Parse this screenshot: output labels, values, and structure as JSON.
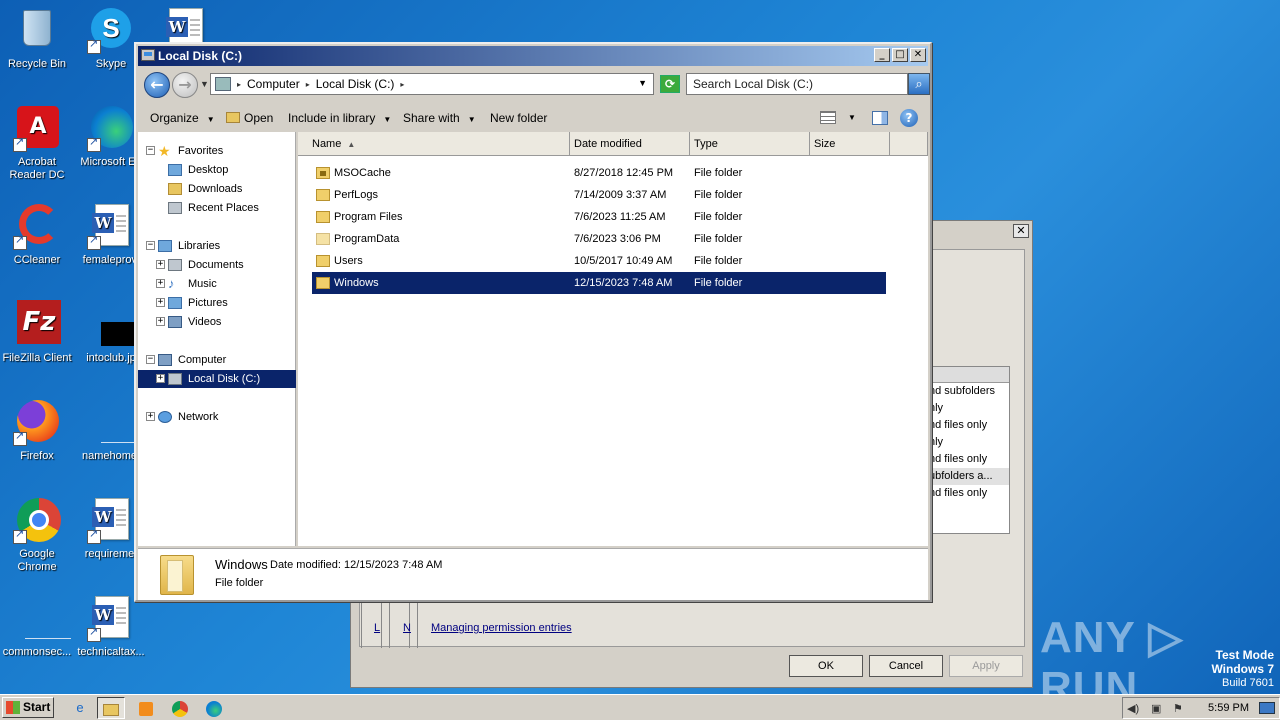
{
  "desktop": {
    "icons": [
      {
        "label": "Recycle Bin",
        "icon": "recycle-bin-icon"
      },
      {
        "label": "Skype",
        "icon": "skype-icon"
      },
      {
        "label": "",
        "icon": "word-document-icon"
      },
      {
        "label": "Acrobat Reader DC",
        "icon": "acrobat-icon"
      },
      {
        "label": "Microsoft Ed",
        "icon": "edge-icon"
      },
      {
        "label": "CCleaner",
        "icon": "ccleaner-icon"
      },
      {
        "label": "femaleprovi",
        "icon": "word-document-icon"
      },
      {
        "label": "FileZilla Client",
        "icon": "filezilla-icon"
      },
      {
        "label": "intoclub.jp",
        "icon": "image-file-icon"
      },
      {
        "label": "Firefox",
        "icon": "firefox-icon"
      },
      {
        "label": "namehome.",
        "icon": "file-icon"
      },
      {
        "label": "Google Chrome",
        "icon": "chrome-icon"
      },
      {
        "label": "requireme.",
        "icon": "word-document-icon"
      },
      {
        "label": "commonsec...",
        "icon": "file-icon"
      },
      {
        "label": "technicaltax...",
        "icon": "word-document-icon"
      }
    ]
  },
  "background_dialog": {
    "list_items": [
      "nd subfolders",
      "nly",
      "nd files only",
      "nly",
      "nd files only",
      "ubfolders a...",
      "nd files only"
    ],
    "link_fragments": [
      "L",
      "N"
    ],
    "link": "Managing permission entries",
    "buttons": {
      "ok": "OK",
      "cancel": "Cancel",
      "apply": "Apply"
    },
    "close": "✕"
  },
  "explorer": {
    "title": "Local Disk (C:)",
    "title_buttons": {
      "minimize": "_",
      "maximize": "□",
      "close": "✕"
    },
    "address": {
      "segments": [
        "Computer",
        "Local Disk (C:)"
      ]
    },
    "search_placeholder": "Search Local Disk (C:)",
    "toolbar": {
      "organize": "Organize",
      "open": "Open",
      "include": "Include in library",
      "share": "Share with",
      "new_folder": "New folder"
    },
    "nav": {
      "favorites": "Favorites",
      "desktop": "Desktop",
      "downloads": "Downloads",
      "recent": "Recent Places",
      "libraries": "Libraries",
      "documents": "Documents",
      "music": "Music",
      "pictures": "Pictures",
      "videos": "Videos",
      "computer": "Computer",
      "local_disk": "Local Disk (C:)",
      "network": "Network"
    },
    "columns": {
      "name": "Name",
      "date": "Date modified",
      "type": "Type",
      "size": "Size"
    },
    "files": [
      {
        "name": "MSOCache",
        "date": "8/27/2018 12:45 PM",
        "type": "File folder"
      },
      {
        "name": "PerfLogs",
        "date": "7/14/2009 3:37 AM",
        "type": "File folder"
      },
      {
        "name": "Program Files",
        "date": "7/6/2023 11:25 AM",
        "type": "File folder"
      },
      {
        "name": "ProgramData",
        "date": "7/6/2023 3:06 PM",
        "type": "File folder"
      },
      {
        "name": "Users",
        "date": "10/5/2017 10:49 AM",
        "type": "File folder"
      },
      {
        "name": "Windows",
        "date": "12/15/2023 7:48 AM",
        "type": "File folder"
      }
    ],
    "details": {
      "name": "Windows",
      "modified": "Date modified: 12/15/2023 7:48 AM",
      "type": "File folder"
    }
  },
  "watermark": "ANY ▷ RUN",
  "test_mode": {
    "line1": "Test Mode",
    "line2": "Windows 7",
    "line3": "Build 7601"
  },
  "taskbar": {
    "start": "Start",
    "clock": "5:59 PM"
  }
}
